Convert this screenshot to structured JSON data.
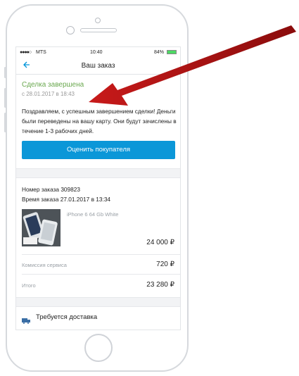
{
  "status_bar": {
    "signal": "●●●●○",
    "carrier": "MTS",
    "time": "10:40",
    "battery": "84%"
  },
  "nav": {
    "back_icon": "back-arrow-icon",
    "title": "Ваш заказ"
  },
  "deal": {
    "status": "Сделка завершена",
    "date": "с 28.01.2017 в 18:43",
    "message": "Поздравляем, с успешным завершением сделки! Деньги были переведены на вашу карту. Они будут зачислены в течение 1-3 рабочих дней.",
    "rate_button": "Оценить покупателя"
  },
  "order": {
    "number": "Номер заказа 309823",
    "time": "Время заказа 27.01.2017 в 13:34",
    "product_name": "iPhone 6 64 Gb White",
    "price": "24 000 ₽",
    "commission_label": "Комиссия сервиса",
    "commission_value": "720 ₽",
    "total_label": "Итого",
    "total_value": "23 280 ₽"
  },
  "delivery": {
    "icon": "truck-icon",
    "label": "Требуется доставка"
  },
  "colors": {
    "accent": "#0b97d8",
    "success": "#6aa84f",
    "annotation_arrow": "#b01010"
  }
}
